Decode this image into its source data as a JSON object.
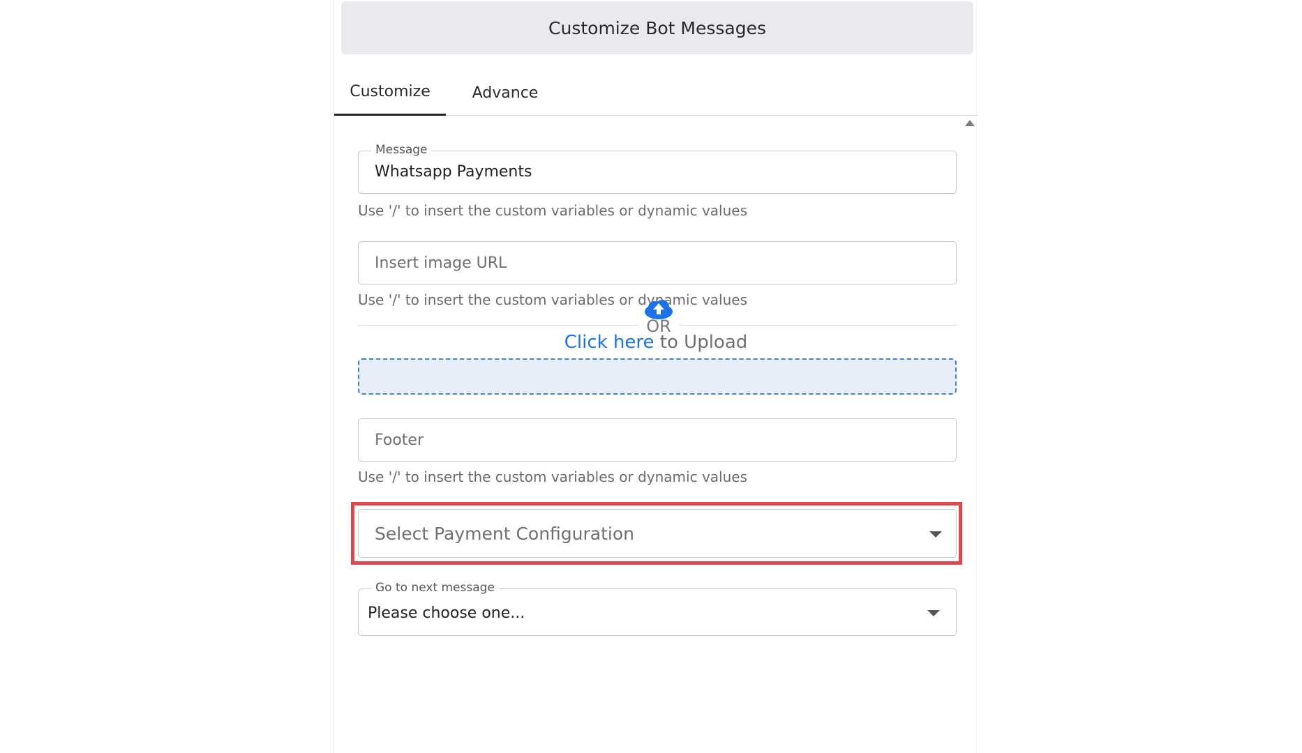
{
  "header": {
    "title": "Customize Bot Messages"
  },
  "tabs": [
    {
      "label": "Customize",
      "active": true
    },
    {
      "label": "Advance",
      "active": false
    }
  ],
  "form": {
    "message": {
      "legend": "Message",
      "value": "Whatsapp Payments",
      "hint": "Use '/' to insert the custom variables or dynamic values"
    },
    "image_url": {
      "placeholder": "Insert image URL",
      "hint": "Use '/' to insert the custom variables or dynamic values"
    },
    "upload": {
      "or_label": "OR",
      "link_text": "Click here",
      "suffix_text": " to Upload"
    },
    "footer": {
      "placeholder": "Footer",
      "hint": "Use '/' to insert the custom variables or dynamic values"
    },
    "payment_configuration": {
      "placeholder": "Select Payment Configuration"
    },
    "next_message": {
      "legend": "Go to next message",
      "value": "Please choose one..."
    }
  },
  "colors": {
    "accent_link": "#1a73e8",
    "highlight_border": "#e0484f",
    "dropzone_fill": "#e8eef8",
    "header_fill": "#e9e9ee"
  },
  "icons": {
    "upload": "cloud-upload-icon",
    "dropdown": "caret-down-icon",
    "scroll": "scroll-up-arrow-icon"
  }
}
